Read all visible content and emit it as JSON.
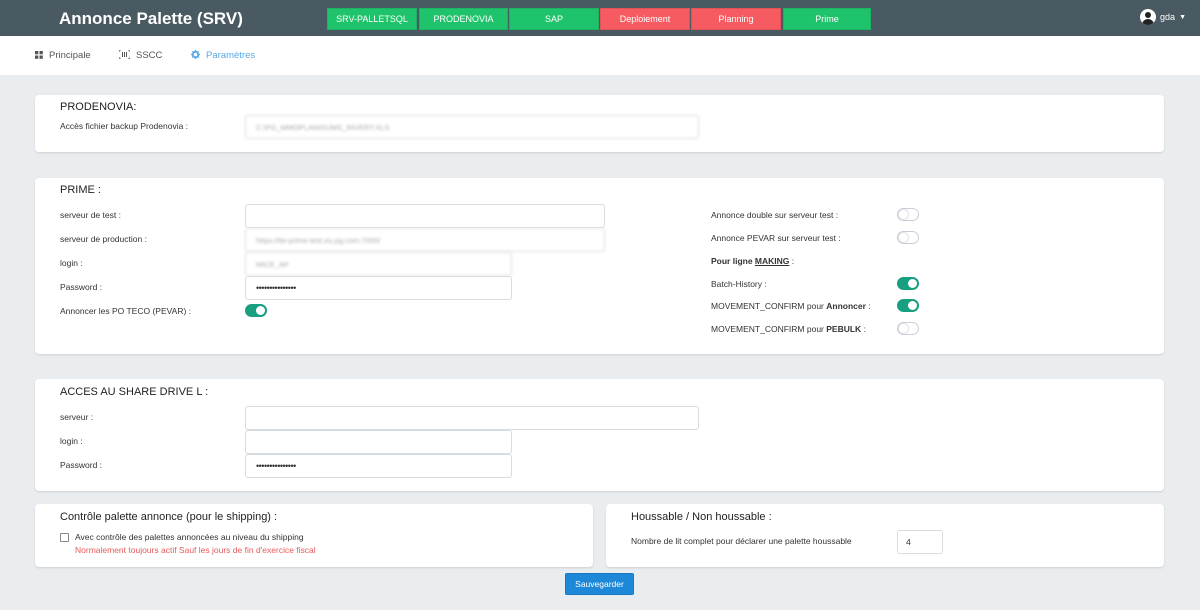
{
  "header": {
    "title": "Annonce Palette (SRV)",
    "servers": [
      {
        "label": "SRV-PALLETSQL",
        "color": "#1fc36b"
      },
      {
        "label": "PRODENOVIA",
        "color": "#1fc36b"
      },
      {
        "label": "SAP",
        "color": "#1fc36b"
      },
      {
        "label": "Deploiement",
        "color": "#f55b60"
      },
      {
        "label": "Planning",
        "color": "#f55b60"
      },
      {
        "label": "Prime",
        "color": "#1fc36b"
      }
    ],
    "user": {
      "name": "gda"
    }
  },
  "nav": {
    "tabs": [
      {
        "label": "Principale",
        "icon": "grid-icon"
      },
      {
        "label": "SSCC",
        "icon": "barcode-scan-icon"
      },
      {
        "label": "Paramètres",
        "icon": "gear-icon",
        "active": true
      }
    ]
  },
  "prodenovia": {
    "title": "PRODENOVIA:",
    "backup_label": "Accès fichier backup Prodenovia :",
    "backup_value": "C:\\PG_MMOPLANS\\UMS_INVERY.XLS"
  },
  "prime": {
    "title": "PRIME :",
    "test_label": "serveur de test :",
    "test_value": "",
    "prod_label": "serveur de production :",
    "prod_value": "https://ite-prime-test.eu.pg.com:7000/",
    "login_label": "login :",
    "login_value": "MICE_AP",
    "password_label": "Password :",
    "password_value": "•••••••••••••••",
    "pevar_label": "Annoncer les PO TECO (PEVAR) :",
    "pevar_on": true,
    "double_label": "Annonce double sur serveur test :",
    "double_on": false,
    "pevar_test_label": "Annonce PEVAR sur serveur test :",
    "pevar_test_on": false,
    "making_prefix": "Pour ligne ",
    "making_word": "MAKING",
    "making_suffix": " :",
    "batch_label": "Batch-History :",
    "batch_on": true,
    "mc_annoncer_prefix": "MOVEMENT_CONFIRM pour ",
    "mc_annoncer_word": "Annoncer",
    "mc_annoncer_suffix": " :",
    "mc_annoncer_on": true,
    "mc_pebulk_prefix": "MOVEMENT_CONFIRM pour ",
    "mc_pebulk_word": "PEBULK",
    "mc_pebulk_suffix": " :",
    "mc_pebulk_on": false
  },
  "share": {
    "title": "ACCES AU SHARE DRIVE L :",
    "server_label": "serveur :",
    "server_value": "",
    "login_label": "login :",
    "login_value": "",
    "password_label": "Password :",
    "password_value": "•••••••••••••••"
  },
  "controle": {
    "title": "Contrôle palette annonce (pour le shipping) :",
    "checkbox_label": "Avec contrôle des palettes annoncées au niveau du shipping",
    "checked": false,
    "note": "Normalement toujours actif  Sauf les jours de fin d'exercice fiscal"
  },
  "houssable": {
    "title": "Houssable / Non houssable :",
    "label": "Nombre de lit complet pour déclarer une palette houssable",
    "value": "4"
  },
  "save_label": "Sauvegarder"
}
